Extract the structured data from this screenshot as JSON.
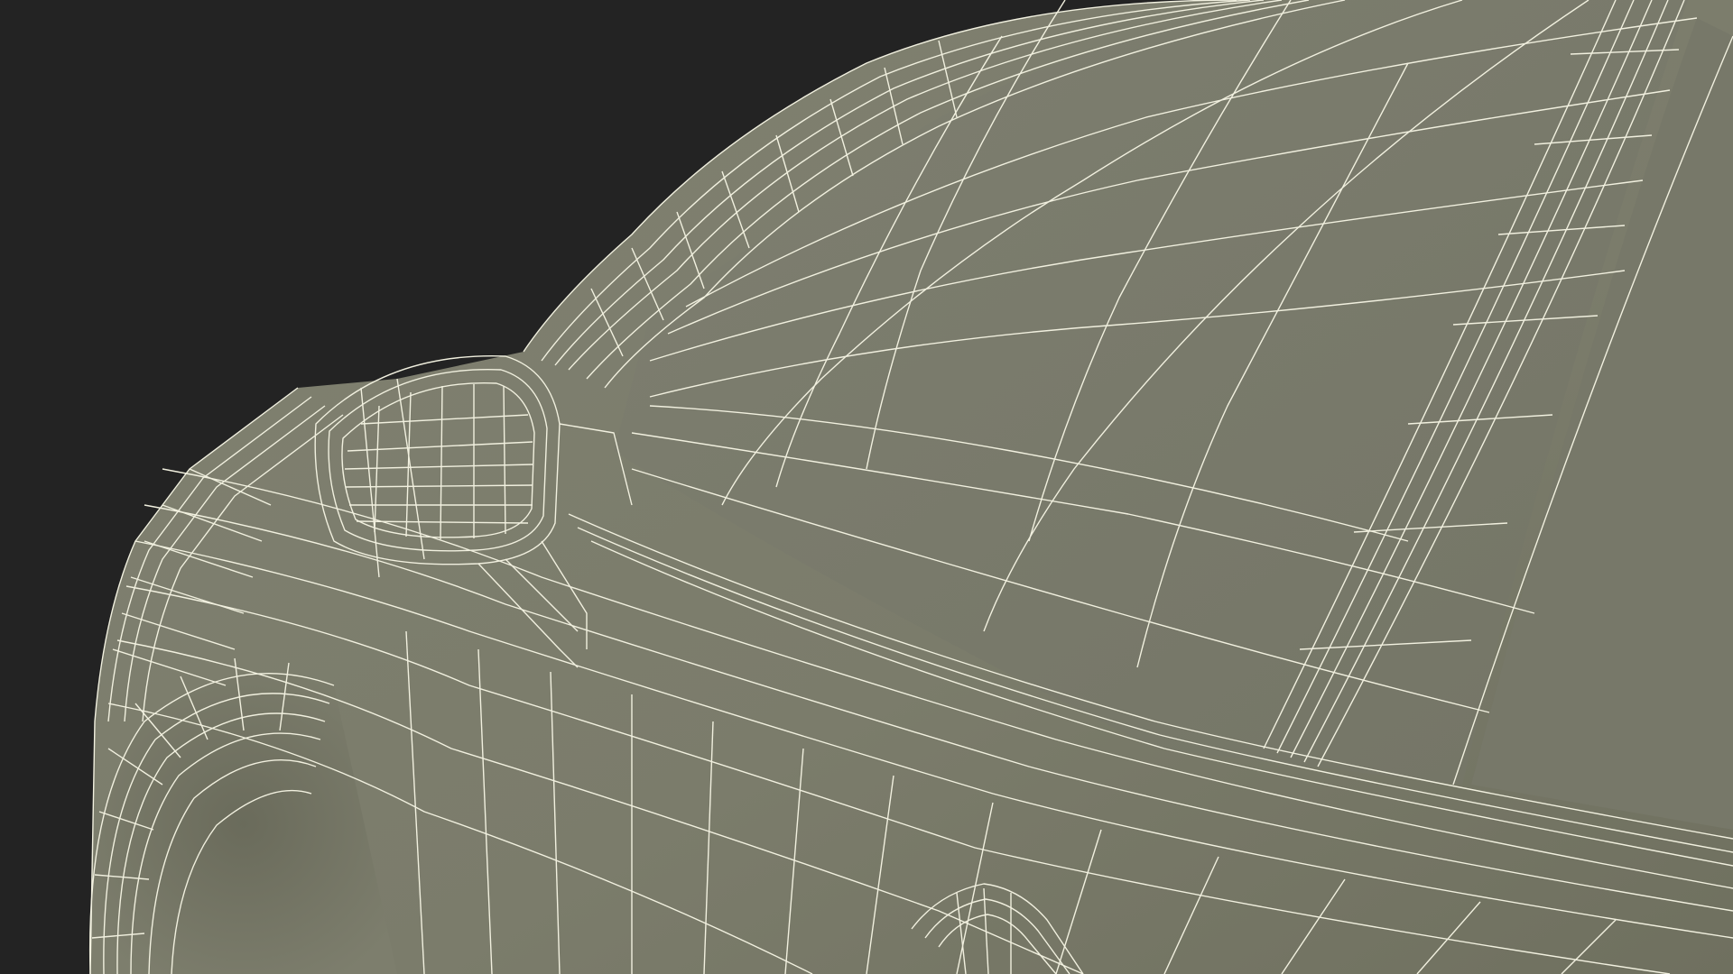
{
  "scene": {
    "subject": "car-wireframe-render",
    "colors": {
      "background": "#232323",
      "body_surface": "#7c7d6c",
      "body_surface_shadow": "#6b6c5c",
      "glass_surface": "#76776a",
      "wireframe_line": "#f1f0df"
    }
  }
}
